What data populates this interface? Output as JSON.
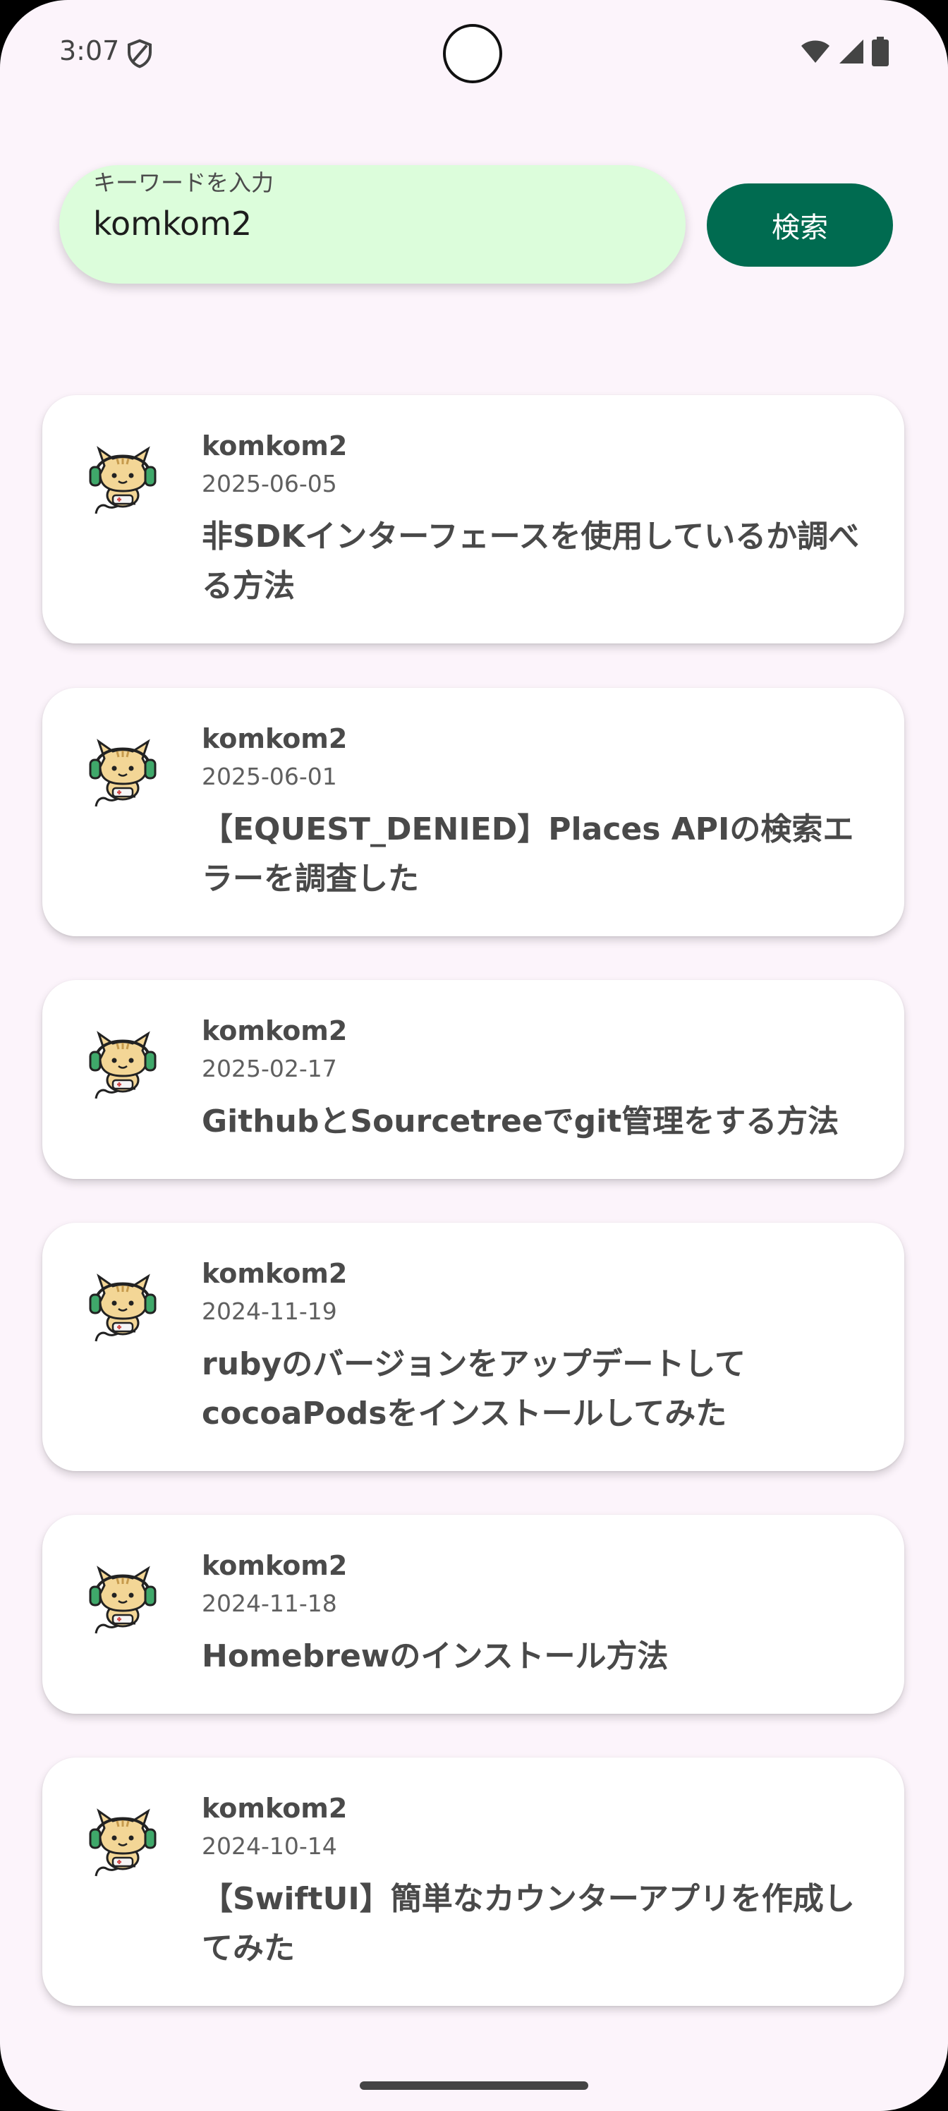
{
  "status_bar": {
    "time": "3:07",
    "icons": [
      "shield-icon",
      "wifi-icon",
      "signal-icon",
      "battery-icon"
    ]
  },
  "search": {
    "label": "キーワードを入力",
    "value": "komkom2",
    "button_label": "検索"
  },
  "colors": {
    "background": "#fcf4fb",
    "search_field": "#dcfddb",
    "search_button": "#006b50",
    "card": "#ffffff"
  },
  "articles": [
    {
      "author": "komkom2",
      "date": "2025-06-05",
      "title": "非SDKインターフェースを使用しているか調べる方法",
      "avatar": "cat-headphones-avatar"
    },
    {
      "author": "komkom2",
      "date": "2025-06-01",
      "title": "【EQUEST_DENIED】Places APIの検索エラーを調査した",
      "avatar": "cat-headphones-avatar"
    },
    {
      "author": "komkom2",
      "date": "2025-02-17",
      "title": "GithubとSourcetreeでgit管理をする方法",
      "avatar": "cat-headphones-avatar"
    },
    {
      "author": "komkom2",
      "date": "2024-11-19",
      "title": "rubyのバージョンをアップデートしてcocoaPodsをインストールしてみた",
      "avatar": "cat-headphones-avatar"
    },
    {
      "author": "komkom2",
      "date": "2024-11-18",
      "title": "Homebrewのインストール方法",
      "avatar": "cat-headphones-avatar"
    },
    {
      "author": "komkom2",
      "date": "2024-10-14",
      "title": "【SwiftUI】簡単なカウンターアプリを作成してみた",
      "avatar": "cat-headphones-avatar"
    }
  ]
}
